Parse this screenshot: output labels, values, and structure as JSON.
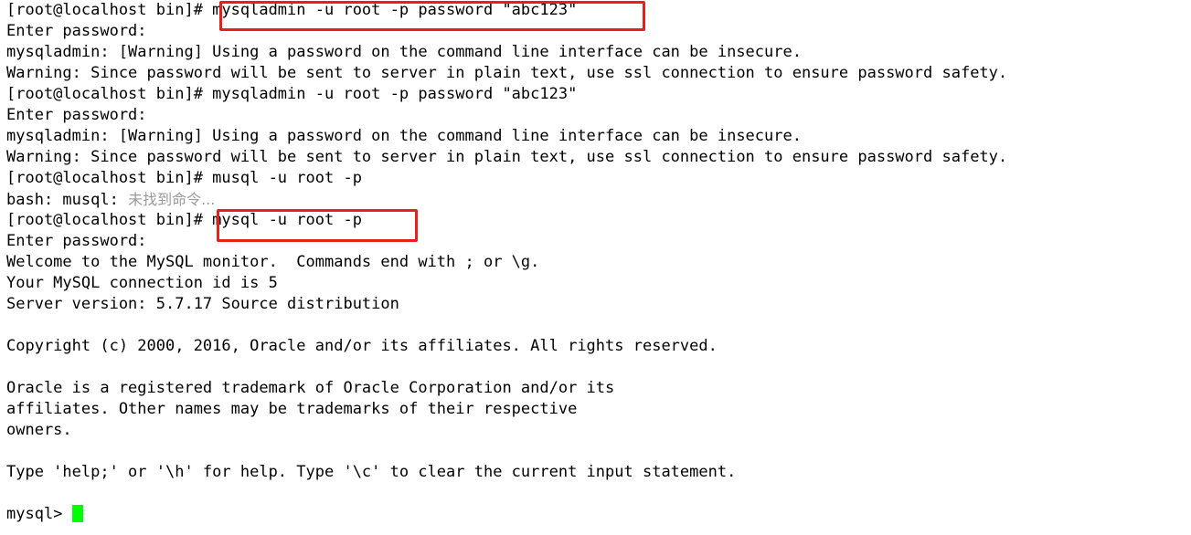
{
  "terminal": {
    "prompt": "[root@localhost bin]#",
    "shell_prompt_mysql": "mysql>",
    "cursor_color": "#00ff00",
    "highlight_color": "#e8201a",
    "background_color": "#ffffff",
    "foreground_color": "#000000",
    "lines": [
      {
        "id": "line-1",
        "text": "[root@localhost bin]# mysqladmin -u root -p password \"abc123\"",
        "type": "command"
      },
      {
        "id": "line-2",
        "text": "Enter password:",
        "type": "output"
      },
      {
        "id": "line-3",
        "text": "mysqladmin: [Warning] Using a password on the command line interface can be insecure.",
        "type": "warning"
      },
      {
        "id": "line-4",
        "text": "Warning: Since password will be sent to server in plain text, use ssl connection to ensure password safety.",
        "type": "warning"
      },
      {
        "id": "line-5",
        "text": "[root@localhost bin]# mysqladmin -u root -p password \"abc123\"",
        "type": "command"
      },
      {
        "id": "line-6",
        "text": "Enter password:",
        "type": "output"
      },
      {
        "id": "line-7",
        "text": "mysqladmin: [Warning] Using a password on the command line interface can be insecure.",
        "type": "warning"
      },
      {
        "id": "line-8",
        "text": "Warning: Since password will be sent to server in plain text, use ssl connection to ensure password safety.",
        "type": "warning"
      },
      {
        "id": "line-9",
        "text": "[root@localhost bin]# musql -u root -p",
        "type": "command"
      },
      {
        "id": "line-10",
        "text": "bash: musql: ",
        "suffix_cn": "未找到命令...",
        "type": "error"
      },
      {
        "id": "line-11",
        "text": "[root@localhost bin]# mysql -u root -p",
        "type": "command"
      },
      {
        "id": "line-12",
        "text": "Enter password:",
        "type": "output"
      },
      {
        "id": "line-13",
        "text": "Welcome to the MySQL monitor.  Commands end with ; or \\g.",
        "type": "output"
      },
      {
        "id": "line-14",
        "text": "Your MySQL connection id is 5",
        "type": "output"
      },
      {
        "id": "line-15",
        "text": "Server version: 5.7.17 Source distribution",
        "type": "output"
      },
      {
        "id": "line-16",
        "text": "",
        "type": "blank"
      },
      {
        "id": "line-17",
        "text": "Copyright (c) 2000, 2016, Oracle and/or its affiliates. All rights reserved.",
        "type": "output"
      },
      {
        "id": "line-18",
        "text": "",
        "type": "blank"
      },
      {
        "id": "line-19",
        "text": "Oracle is a registered trademark of Oracle Corporation and/or its",
        "type": "output"
      },
      {
        "id": "line-20",
        "text": "affiliates. Other names may be trademarks of their respective",
        "type": "output"
      },
      {
        "id": "line-21",
        "text": "owners.",
        "type": "output"
      },
      {
        "id": "line-22",
        "text": "",
        "type": "blank"
      },
      {
        "id": "line-23",
        "text": "Type 'help;' or '\\h' for help. Type '\\c' to clear the current input statement.",
        "type": "output"
      },
      {
        "id": "line-24",
        "text": "",
        "type": "blank"
      },
      {
        "id": "line-25",
        "text": "mysql> ",
        "type": "prompt",
        "has_cursor": true
      }
    ],
    "highlights": [
      {
        "id": "highlight-1",
        "label": "mysqladmin -u root -p password \"abc123\""
      },
      {
        "id": "highlight-2",
        "label": "mysql -u root -p"
      }
    ]
  }
}
